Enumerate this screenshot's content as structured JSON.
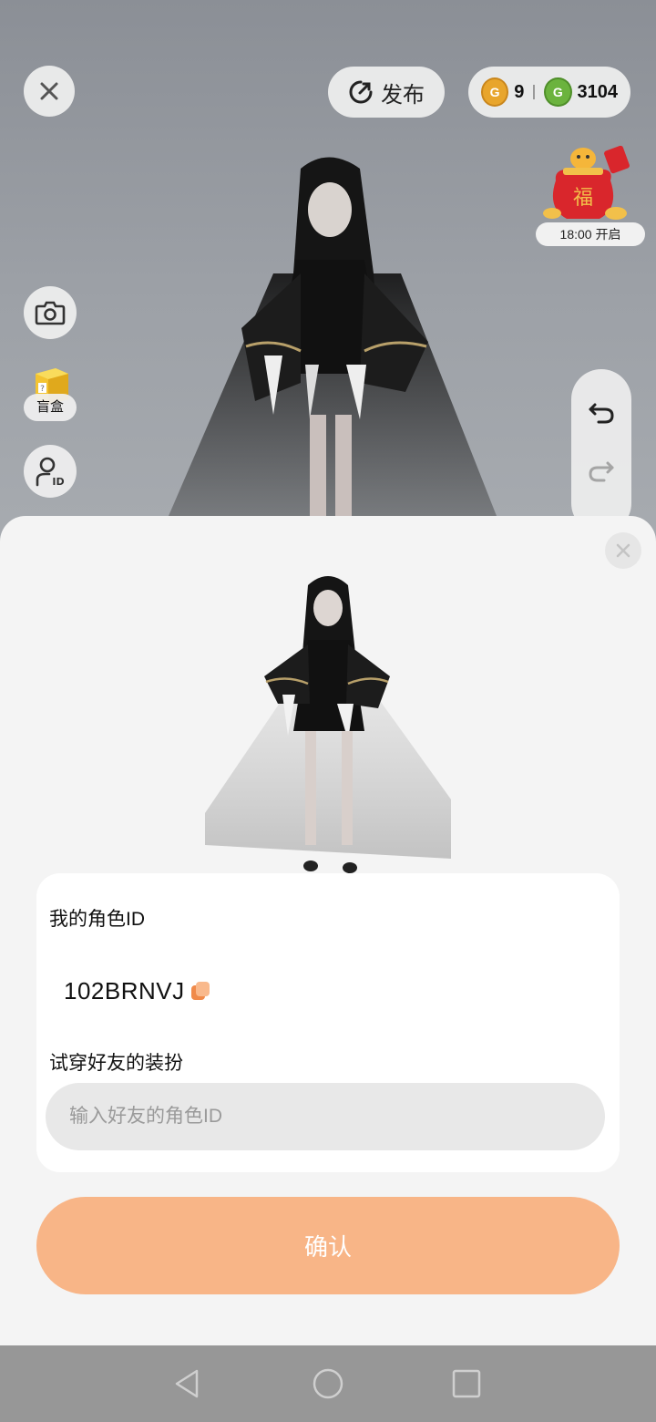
{
  "top_bar": {
    "publish_label": "发布",
    "coin_gold_count": "9",
    "coin_green_count": "3104"
  },
  "event": {
    "time_label": "18:00 开启",
    "bag_char": "福"
  },
  "left_tools": {
    "blind_box_label": "盲盒",
    "id_badge": "ID"
  },
  "sheet": {
    "my_id_label": "我的角色ID",
    "my_id_value": "102BRNVJ",
    "try_on_label": "试穿好友的装扮",
    "input_placeholder": "输入好友的角色ID",
    "confirm_label": "确认"
  },
  "colors": {
    "accent": "#f8b587",
    "gold_coin": "#e8a52c",
    "green_coin": "#6bb33e"
  }
}
